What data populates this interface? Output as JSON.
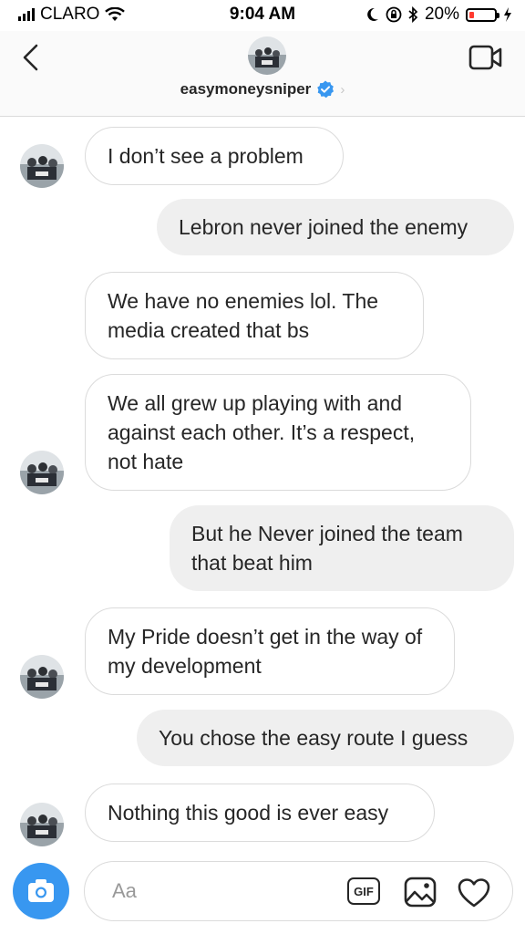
{
  "status_bar": {
    "carrier": "CLARO",
    "time": "9:04 AM",
    "battery_text": "20%",
    "battery_level": 0.2,
    "battery_color": "#ff3b30"
  },
  "header": {
    "username": "easymoneysniper",
    "verified_color": "#3897f0",
    "icons": [
      "back-chevron-icon",
      "video-call-icon",
      "verified-badge-icon",
      "chevron-right-icon"
    ]
  },
  "messages": [
    {
      "from": "them",
      "text": "I don’t see a problem"
    },
    {
      "from": "me",
      "text": "Lebron never joined the enemy"
    },
    {
      "from": "them",
      "text": "We have no enemies lol. The media created that bs"
    },
    {
      "from": "them",
      "text": "We all grew up playing with and against each other. It’s a respect, not hate"
    },
    {
      "from": "me",
      "text": "But he Never joined the team that beat him"
    },
    {
      "from": "them",
      "text": "My Pride doesn’t get in the way of my development"
    },
    {
      "from": "me",
      "text": "You chose the easy route I guess"
    },
    {
      "from": "them",
      "text": "Nothing this good is ever easy"
    }
  ],
  "composer": {
    "placeholder": "Aa",
    "gif_label": "GIF",
    "camera_color": "#3897f0",
    "icons": [
      "camera-icon",
      "gif-icon",
      "photo-icon",
      "heart-icon"
    ]
  }
}
